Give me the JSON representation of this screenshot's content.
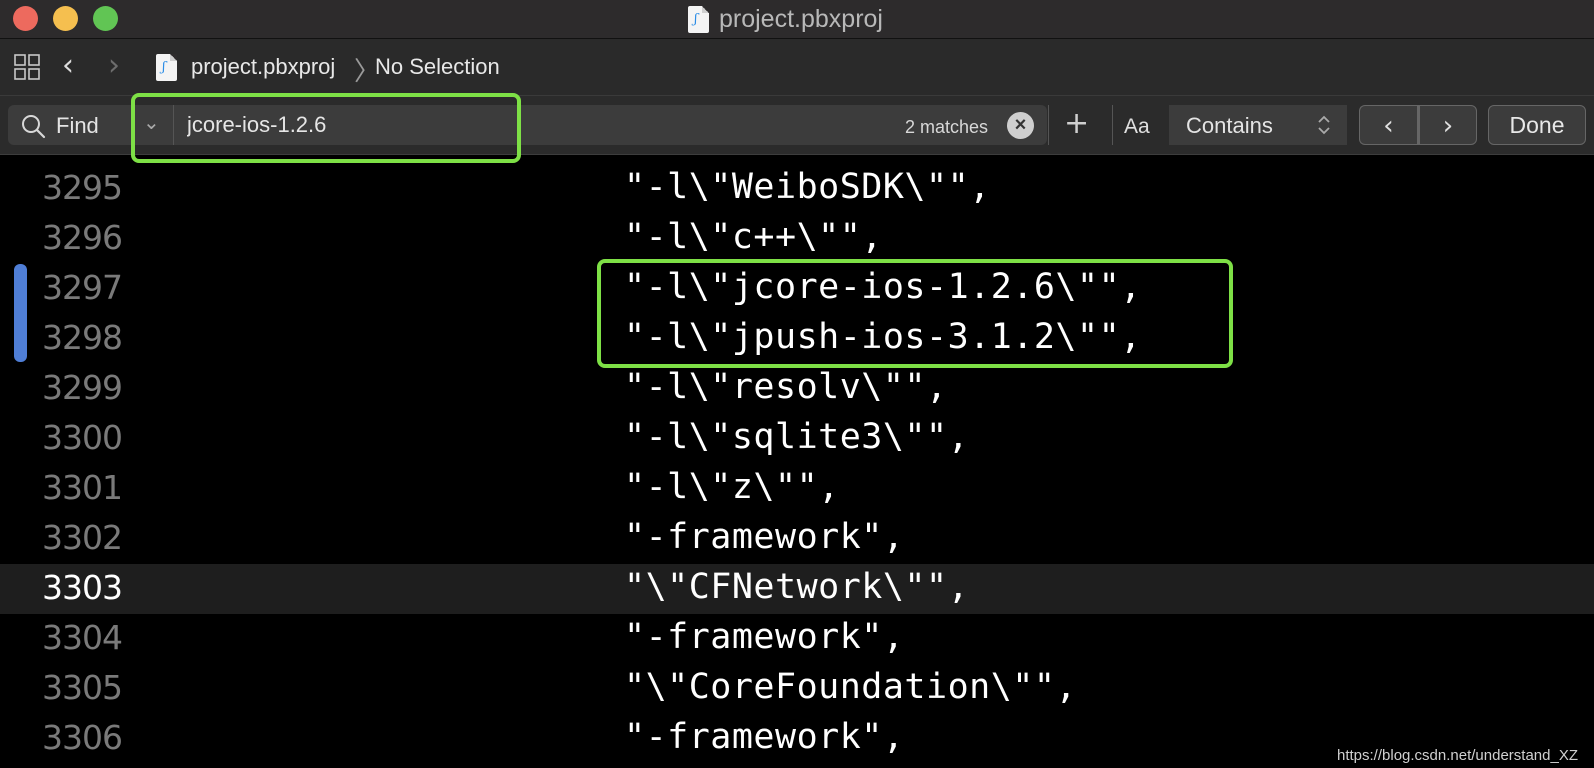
{
  "window": {
    "title": "project.pbxproj",
    "controls": [
      "close",
      "minimize",
      "zoom"
    ]
  },
  "navbar": {
    "icons": [
      "grid-icon",
      "chevron-left-icon",
      "chevron-right-icon",
      "file-icon"
    ],
    "breadcrumb": {
      "file": "project.pbxproj",
      "separator": "〉",
      "selection": "No Selection"
    }
  },
  "findbar": {
    "mode_label": "Find",
    "query": "jcore-ios-1.2.6",
    "match_count": "2 matches",
    "case_toggle": "Aa",
    "match_type": "Contains",
    "done_label": "Done",
    "prev_glyph": "‹",
    "next_glyph": "›"
  },
  "editor": {
    "lines": [
      {
        "number": "3295",
        "code": "\"-l\\\"WeiboSDK\\\"\","
      },
      {
        "number": "3296",
        "code": "\"-l\\\"c++\\\"\","
      },
      {
        "number": "3297",
        "code": "\"-l\\\"jcore-ios-1.2.6\\\"\","
      },
      {
        "number": "3298",
        "code": "\"-l\\\"jpush-ios-3.1.2\\\"\","
      },
      {
        "number": "3299",
        "code": "\"-l\\\"resolv\\\"\","
      },
      {
        "number": "3300",
        "code": "\"-l\\\"sqlite3\\\"\","
      },
      {
        "number": "3301",
        "code": "\"-l\\\"z\\\"\","
      },
      {
        "number": "3302",
        "code": "\"-framework\","
      },
      {
        "number": "3303",
        "code": "\"\\\"CFNetwork\\\"\","
      },
      {
        "number": "3304",
        "code": "\"-framework\","
      },
      {
        "number": "3305",
        "code": "\"\\\"CoreFoundation\\\"\","
      },
      {
        "number": "3306",
        "code": "\"-framework\","
      }
    ],
    "current_line": "3303"
  },
  "colors": {
    "highlight_box": "#7ee046",
    "gutter_marker": "#4f7ed6",
    "background": "#000000"
  },
  "watermark": "https://blog.csdn.net/understand_XZ"
}
